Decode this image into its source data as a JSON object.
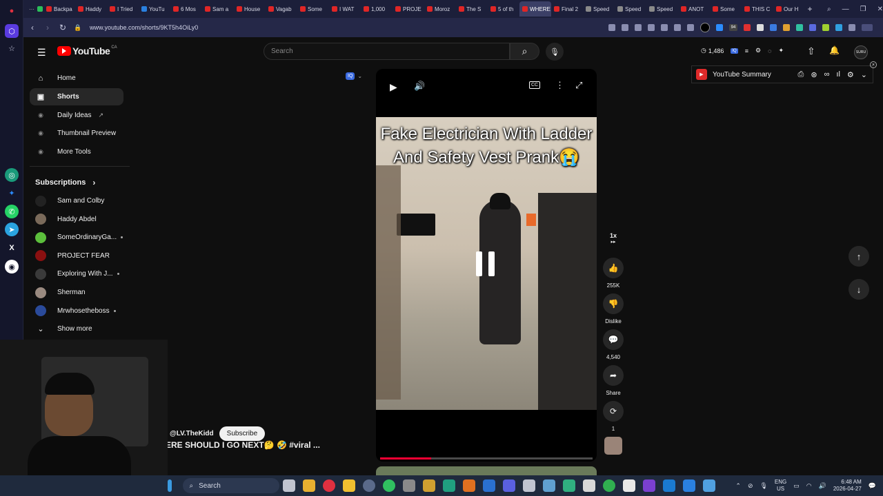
{
  "browser": {
    "tabs": [
      {
        "label": "Backpa"
      },
      {
        "label": "Haddy"
      },
      {
        "label": "I Tried"
      },
      {
        "label": "YouTu"
      },
      {
        "label": "6 Mos"
      },
      {
        "label": "Sam a"
      },
      {
        "label": "House"
      },
      {
        "label": "Vagab"
      },
      {
        "label": "Some"
      },
      {
        "label": "I WAT"
      },
      {
        "label": "1,000"
      },
      {
        "label": "PROJE"
      },
      {
        "label": "Moroz"
      },
      {
        "label": "The S"
      },
      {
        "label": "5 of th"
      },
      {
        "label": "WHERE"
      },
      {
        "label": "Final 2"
      },
      {
        "label": "Speed"
      },
      {
        "label": "Speed"
      },
      {
        "label": "Speed"
      },
      {
        "label": "ANOT"
      },
      {
        "label": "Some"
      },
      {
        "label": "THIS C"
      },
      {
        "label": "Our H"
      }
    ],
    "new_tab_symbol": "+",
    "url": "www.youtube.com/shorts/9KT5h4OiLy0",
    "badge_count": "94"
  },
  "youtube": {
    "logo_text": "YouTube",
    "region": "CA",
    "search_placeholder": "Search",
    "view_counter": "1,486",
    "sidebar": {
      "main": [
        {
          "label": "Home",
          "icon": "home-icon"
        },
        {
          "label": "Shorts",
          "icon": "shorts-icon"
        },
        {
          "label": "Daily Ideas",
          "icon": "iq-icon"
        },
        {
          "label": "Thumbnail Preview",
          "icon": "iq-icon"
        },
        {
          "label": "More Tools",
          "icon": "iq-icon"
        }
      ],
      "subscriptions_title": "Subscriptions",
      "subscriptions": [
        {
          "name": "Sam and Colby",
          "avatar_color": "#222222",
          "dot": false
        },
        {
          "name": "Haddy Abdel",
          "avatar_color": "#7a6a5a",
          "dot": false
        },
        {
          "name": "SomeOrdinaryGa...",
          "avatar_color": "#5cbf3c",
          "dot": true
        },
        {
          "name": "PROJECT FEAR",
          "avatar_color": "#8a1010",
          "dot": false
        },
        {
          "name": "Exploring With J...",
          "avatar_color": "#3a3a3a",
          "dot": true
        },
        {
          "name": "Sherman",
          "avatar_color": "#9a8a80",
          "dot": false
        },
        {
          "name": "Mrwhosetheboss",
          "avatar_color": "#2a4a9a",
          "dot": true
        }
      ],
      "show_more": "Show more"
    },
    "extension_panel": {
      "title": "YouTube Summary"
    },
    "short": {
      "caption": "Fake Electrician With Ladder And Safety Vest Prank😭",
      "channel": "@LV.TheKidd",
      "subscribe": "Subscribe",
      "title": "ERE SHOULD I GO NEXT🤔 🤣 #viral ...",
      "progress": 0.24
    },
    "actions": {
      "speed": "1x",
      "likes": "255K",
      "dislike": "Dislike",
      "comments": "4,540",
      "share": "Share",
      "remix": "1"
    }
  },
  "taskbar": {
    "search_label": "Search",
    "lang": "ENG",
    "region": "US",
    "time": "6:48 AM",
    "date": "2026-04-27"
  }
}
